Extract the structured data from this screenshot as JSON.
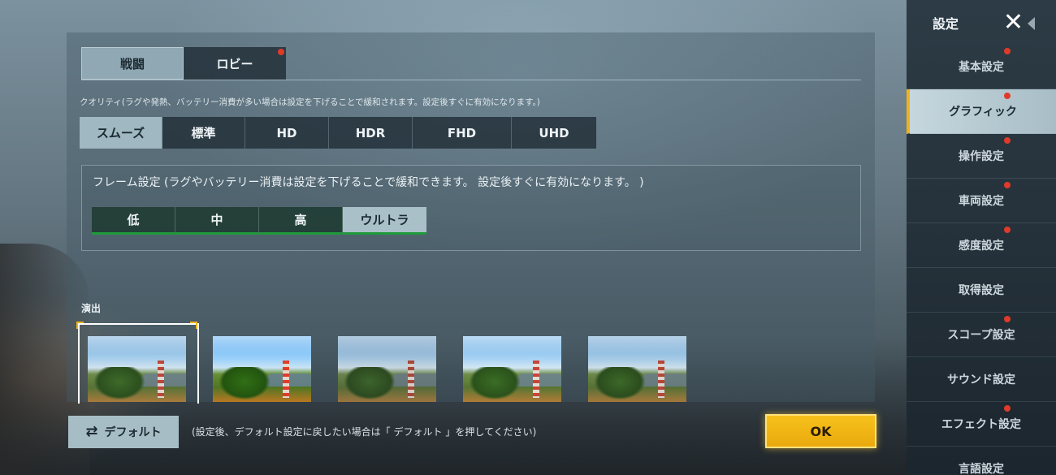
{
  "top_tabs": [
    {
      "label": "戦闘",
      "active": true,
      "badge": false
    },
    {
      "label": "ロビー",
      "active": false,
      "badge": true
    }
  ],
  "quality": {
    "note": "クオリティ(ラグや発熱、バッテリー消費が多い場合は設定を下げることで緩和されます。設定後すぐに有効になります。)",
    "options": [
      {
        "label": "スムーズ",
        "active": true
      },
      {
        "label": "標準",
        "active": false
      },
      {
        "label": "HD",
        "active": false
      },
      {
        "label": "HDR",
        "active": false
      },
      {
        "label": "FHD",
        "active": false
      },
      {
        "label": "UHD",
        "active": false
      }
    ]
  },
  "frame": {
    "note": "フレーム設定 (ラグやバッテリー消費は設定を下げることで緩和できます。 設定後すぐに有効になります。 )",
    "options": [
      {
        "label": "低",
        "active": false
      },
      {
        "label": "中",
        "active": false
      },
      {
        "label": "高",
        "active": false
      },
      {
        "label": "ウルトラ",
        "active": true
      }
    ]
  },
  "effects": {
    "label": "演出",
    "thumbnails": 5,
    "selected_index": 0
  },
  "bottom": {
    "default_label": "デフォルト",
    "default_icon": "swap-icon",
    "default_note": "(設定後、デフォルト設定に戻したい場合は「 デフォルト 」を押してください)",
    "ok_label": "OK"
  },
  "sidebar": {
    "title": "設定",
    "close_icon": "close-icon",
    "items": [
      {
        "label": "基本設定",
        "badge": true,
        "active": false
      },
      {
        "label": "グラフィック",
        "badge": true,
        "active": true
      },
      {
        "label": "操作設定",
        "badge": true,
        "active": false
      },
      {
        "label": "車両設定",
        "badge": true,
        "active": false
      },
      {
        "label": "感度設定",
        "badge": true,
        "active": false
      },
      {
        "label": "取得設定",
        "badge": false,
        "active": false
      },
      {
        "label": "スコープ設定",
        "badge": true,
        "active": false
      },
      {
        "label": "サウンド設定",
        "badge": false,
        "active": false
      },
      {
        "label": "エフェクト設定",
        "badge": true,
        "active": false
      },
      {
        "label": "言語設定",
        "badge": false,
        "active": false
      }
    ]
  },
  "colors": {
    "accent_gold": "#f0b21a",
    "badge_red": "#e03a2a",
    "frame_green": "#1f9a3a"
  }
}
